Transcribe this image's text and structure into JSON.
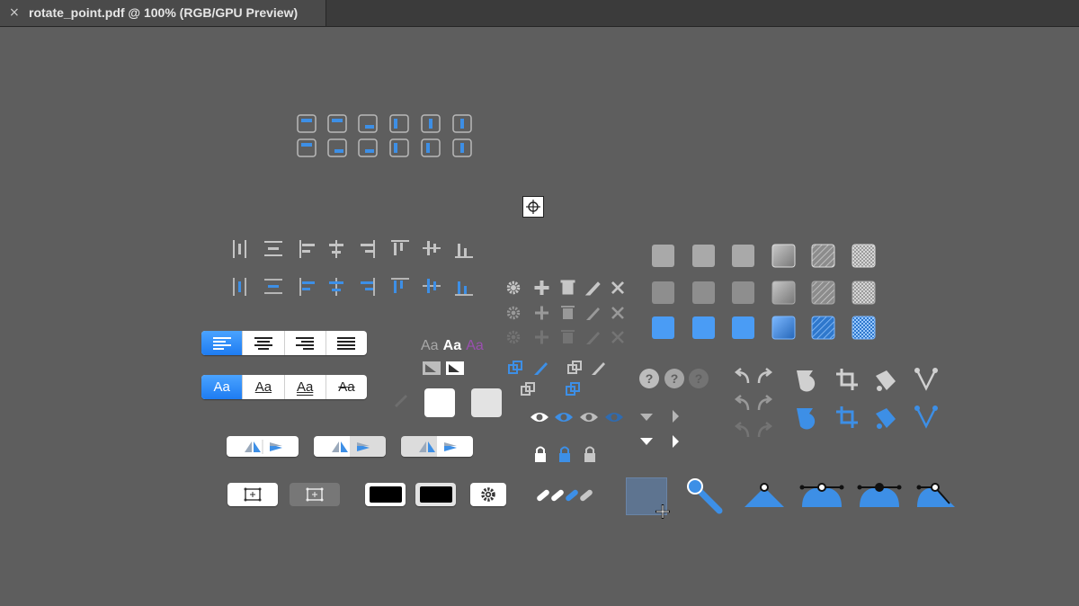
{
  "window": {
    "tab_title": "rotate_point.pdf @ 100% (RGB/GPU Preview)",
    "close_glyph": "×"
  },
  "colors": {
    "accent": "#3d8fe6",
    "blue_fill": "#4a9cf5",
    "gray_icon": "#b3b3b3",
    "dark_gray": "#8a8a8a",
    "background": "#5e5e5e",
    "purple": "#9a4fb0"
  },
  "typography_preview": {
    "sample_gray": "Aa",
    "sample_white": "Aa",
    "sample_purple": "Aa"
  },
  "text_style_buttons": [
    "Aa",
    "Aa",
    "Aa",
    "Aa"
  ],
  "icons": {
    "alignment_grid": "align-distribute-icons",
    "align_row": [
      "distribute-horizontal-icon",
      "distribute-vertical-icon",
      "align-left-icon",
      "align-horizontal-center-icon",
      "align-right-icon",
      "align-top-icon",
      "align-vertical-center-icon",
      "align-bottom-icon"
    ],
    "tool_row": [
      "gear-icon",
      "plus-icon",
      "trash-icon",
      "knife-icon",
      "close-icon"
    ],
    "corner_icons": [
      "undo-icon",
      "redo-icon",
      "mask-shape-icon",
      "crop-icon",
      "paint-bucket-icon",
      "vector-node-icon"
    ]
  }
}
